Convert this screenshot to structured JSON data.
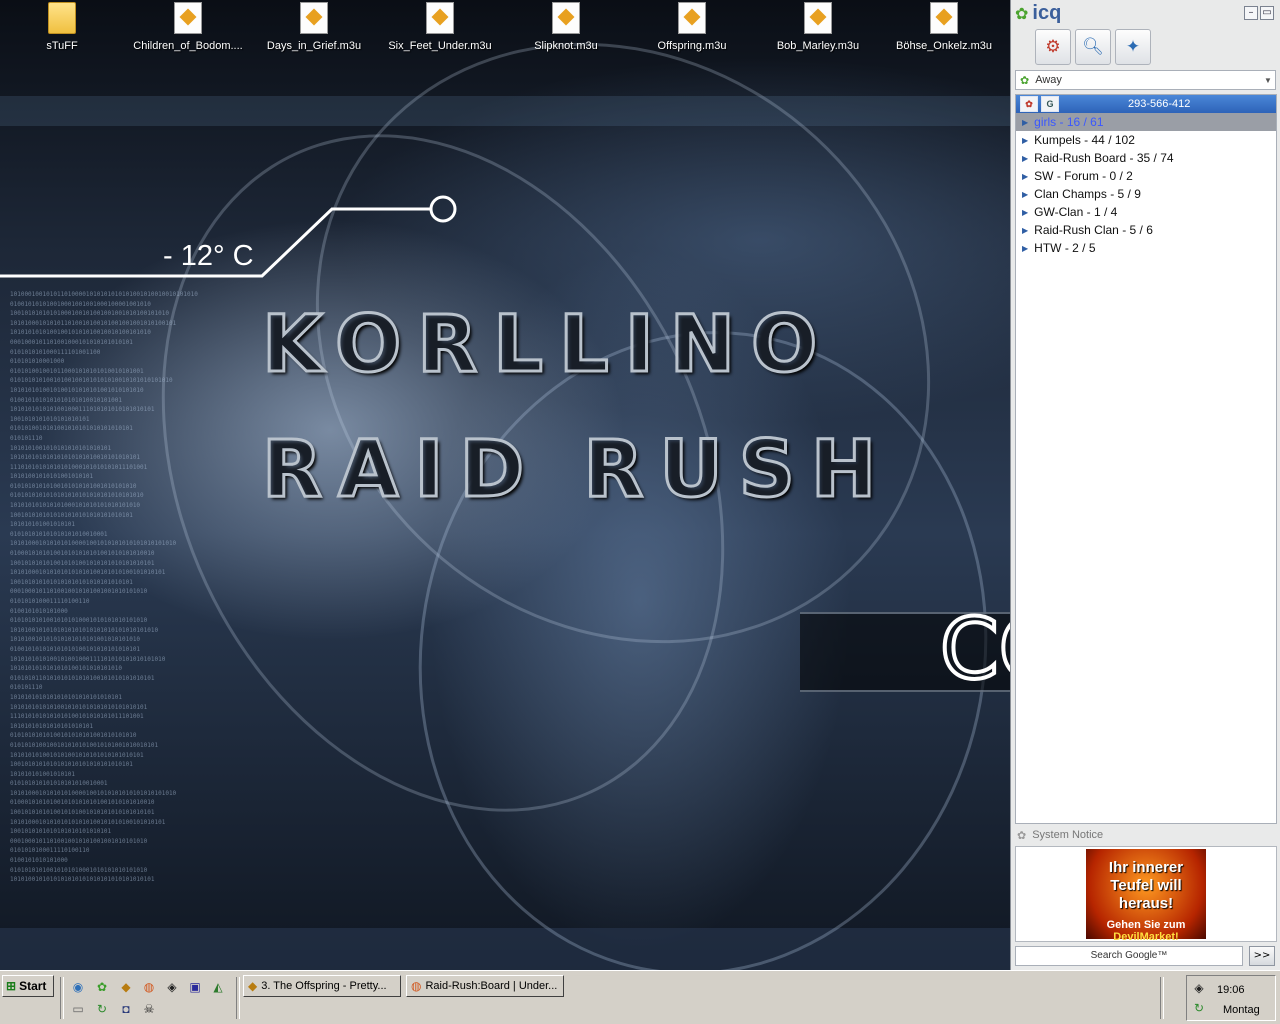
{
  "desktop": {
    "icons": [
      {
        "label": "sTuFF",
        "type": "folder"
      },
      {
        "label": "Children_of_Bodom....",
        "type": "playlist"
      },
      {
        "label": "Days_in_Grief.m3u",
        "type": "playlist"
      },
      {
        "label": "Six_Feet_Under.m3u",
        "type": "playlist"
      },
      {
        "label": "Slipknot.m3u",
        "type": "playlist"
      },
      {
        "label": "Offspring.m3u",
        "type": "playlist"
      },
      {
        "label": "Bob_Marley.m3u",
        "type": "playlist"
      },
      {
        "label": "Böhse_Onkelz.m3u",
        "type": "playlist"
      }
    ],
    "temperature": "- 12° C",
    "logo_line1": "KORLLINO",
    "logo_line2": "RAID RUSH",
    "partial_text": "CO"
  },
  "icq": {
    "title": "icq",
    "status": "Away",
    "uin": "293-566-412",
    "tab_g": "G",
    "groups": [
      {
        "label": "girls  -  16 / 61",
        "selected": true
      },
      {
        "label": "Kumpels  -  44 / 102",
        "selected": false
      },
      {
        "label": "Raid-Rush Board  -  35 / 74",
        "selected": false
      },
      {
        "label": "SW - Forum  -  0 / 2",
        "selected": false
      },
      {
        "label": "Clan Champs  -  5 / 9",
        "selected": false
      },
      {
        "label": "GW-Clan  -  1 / 4",
        "selected": false
      },
      {
        "label": "Raid-Rush Clan  -  5 / 6",
        "selected": false
      },
      {
        "label": "HTW  -  2 / 5",
        "selected": false
      }
    ],
    "system_notice": "System Notice",
    "ad": {
      "line1": "Ihr innerer Teufel will heraus!",
      "line2": "Gehen Sie zum",
      "line3": "DevilMarket!"
    },
    "search_label": "Search Google™",
    "search_go": ">>"
  },
  "taskbar": {
    "start_label": "Start",
    "tasks": [
      {
        "label": "3. The Offspring - Pretty..."
      },
      {
        "label": "Raid-Rush:Board | Under..."
      }
    ],
    "clock": "19:06",
    "day": "Montag"
  },
  "colors": {
    "icq_blue": "#3b5f9b",
    "uin_bar": "#2e63b8",
    "taskbar_bg": "#d4d0c8"
  }
}
